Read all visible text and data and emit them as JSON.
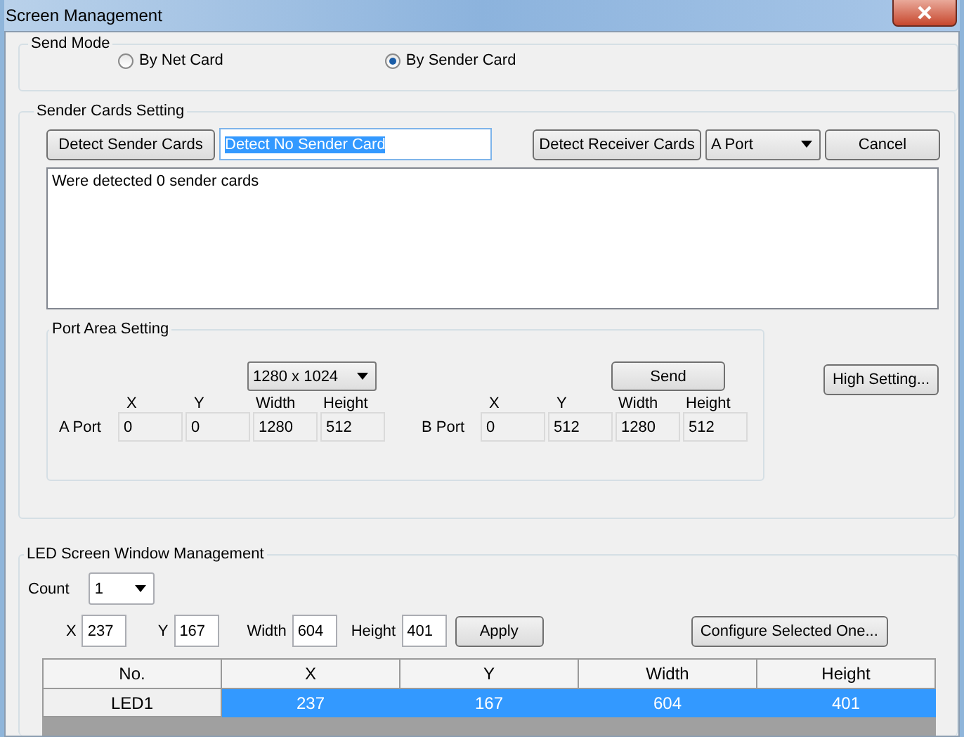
{
  "window": {
    "title": "Screen Management"
  },
  "send_mode": {
    "title": "Send Mode",
    "options": [
      {
        "label": "By Net Card",
        "selected": false
      },
      {
        "label": "By Sender Card",
        "selected": true
      }
    ]
  },
  "sender_cards": {
    "title": "Sender Cards Setting",
    "detect_button": "Detect Sender Cards",
    "status_field": {
      "value": "Detect No Sender Card",
      "selected": true
    },
    "detect_receiver_button": "Detect Receiver Cards",
    "port_select": "A Port",
    "cancel_button": "Cancel",
    "log": "Were detected 0 sender cards",
    "port_area": {
      "title": "Port Area Setting",
      "resolution": "1280 x 1024",
      "send_button": "Send",
      "ports": [
        {
          "label": "A Port",
          "fields": [
            {
              "label": "X",
              "value": "0"
            },
            {
              "label": "Y",
              "value": "0"
            },
            {
              "label": "Width",
              "value": "1280"
            },
            {
              "label": "Height",
              "value": "512"
            }
          ]
        },
        {
          "label": "B Port",
          "fields": [
            {
              "label": "X",
              "value": "0"
            },
            {
              "label": "Y",
              "value": "512"
            },
            {
              "label": "Width",
              "value": "1280"
            },
            {
              "label": "Height",
              "value": "512"
            }
          ]
        }
      ]
    },
    "high_setting_button": "High Setting..."
  },
  "led_management": {
    "title": "LED Screen Window Management",
    "count_label": "Count",
    "count": "1",
    "fields": [
      {
        "label": "X",
        "value": "237"
      },
      {
        "label": "Y",
        "value": "167"
      },
      {
        "label": "Width",
        "value": "604"
      },
      {
        "label": "Height",
        "value": "401"
      }
    ],
    "apply_button": "Apply",
    "configure_button": "Configure Selected One...",
    "table": {
      "columns": [
        "No.",
        "X",
        "Y",
        "Width",
        "Height"
      ],
      "rows": [
        {
          "cells": [
            "LED1",
            "237",
            "167",
            "604",
            "401"
          ],
          "selected": true
        }
      ]
    }
  }
}
